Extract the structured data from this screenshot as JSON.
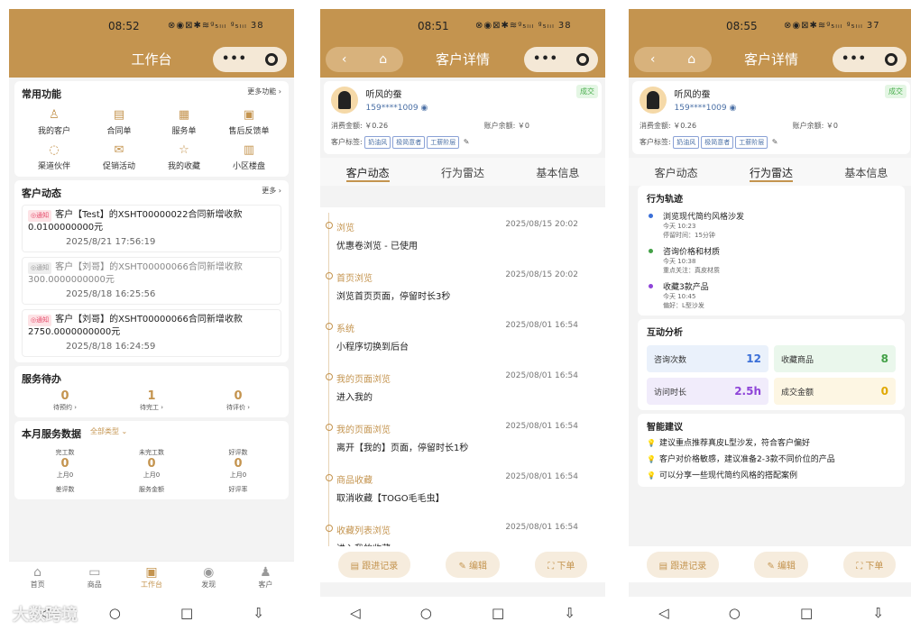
{
  "p1": {
    "time": "08:52",
    "signal": "⊗◉⊠✱≋ᵍ₅ₗᵢₗ ᵍ₅ₗᵢₗ 38",
    "title": "工作台",
    "common": {
      "title": "常用功能",
      "more": "更多功能 ›",
      "items": [
        "我的客户",
        "合同单",
        "服务单",
        "售后反馈单",
        "渠道伙伴",
        "促销活动",
        "我的收藏",
        "小区楼盘"
      ]
    },
    "dyn": {
      "title": "客户动态",
      "more": "更多 ›",
      "items": [
        {
          "tag": "◎通知",
          "text": "客户【Test】的XSHT00000022合同新增收款0.0100000000元",
          "ts": "2025/8/21 17:56:19"
        },
        {
          "tag": "◎通知",
          "text": "客户【刘哥】的XSHT00000066合同新增收款300.0000000000元",
          "ts": "2025/8/18 16:25:56"
        },
        {
          "tag": "◎通知",
          "text": "客户【刘哥】的XSHT00000066合同新增收款2750.0000000000元",
          "ts": "2025/8/18 16:24:59"
        }
      ]
    },
    "todo": {
      "title": "服务待办",
      "items": [
        {
          "n": "0",
          "l": "待预约 ›"
        },
        {
          "n": "1",
          "l": "待完工 ›"
        },
        {
          "n": "0",
          "l": "待评价 ›"
        }
      ]
    },
    "stats": {
      "title": "本月服务数据",
      "filter": "全部类型 ⌄",
      "items": [
        {
          "l": "完工数",
          "n": "0",
          "s": "上月0"
        },
        {
          "l": "未完工数",
          "n": "0",
          "s": "上月0"
        },
        {
          "l": "好评数",
          "n": "0",
          "s": "上月0"
        }
      ],
      "row2": [
        "差评数",
        "服务金额",
        "好评率"
      ]
    },
    "tabs": [
      "首页",
      "商品",
      "工作台",
      "发现",
      "客户"
    ]
  },
  "p2": {
    "time": "08:51",
    "signal": "⊗◉⊠✱≋ᵍ₅ₗᵢₗ ᵍ₅ₗᵢₗ 38",
    "title": "客户详情",
    "cust": {
      "name": "听风的蚕",
      "phone": "159****1009",
      "badge": "成交",
      "consume": "消费金额: ￥0.26",
      "balance": "账户余额: ￥0",
      "tags_label": "客户标签:",
      "tags": [
        "奶油风",
        "极简意者",
        "工薪阶层"
      ]
    },
    "tabs": [
      "客户动态",
      "行为雷达",
      "基本信息"
    ],
    "timeline": [
      {
        "t": "浏览",
        "d": "2025/08/15 20:02",
        "x": "优惠卷浏览 - 已使用"
      },
      {
        "t": "首页浏览",
        "d": "2025/08/15 20:02",
        "x": "浏览首页页面，停留时长3秒"
      },
      {
        "t": "系统",
        "d": "2025/08/01 16:54",
        "x": "小程序切换到后台"
      },
      {
        "t": "我的页面浏览",
        "d": "2025/08/01 16:54",
        "x": "进入我的"
      },
      {
        "t": "我的页面浏览",
        "d": "2025/08/01 16:54",
        "x": "离开【我的】页面，停留时长1秒"
      },
      {
        "t": "商品收藏",
        "d": "2025/08/01 16:54",
        "x": "取消收藏【TOGO毛毛虫】"
      },
      {
        "t": "收藏列表浏览",
        "d": "2025/08/01 16:54",
        "x": "进入我的收藏"
      }
    ],
    "actions": [
      "跟进记录",
      "编辑",
      "下单"
    ]
  },
  "p3": {
    "time": "08:55",
    "signal": "⊗◉⊠✱≋ᵍ₅ₗᵢₗ ᵍ₅ₗᵢₗ 37",
    "title": "客户详情",
    "track": {
      "title": "行为轨迹",
      "items": [
        {
          "a": "浏览现代简约风格沙发",
          "b": "今天 10:23",
          "c": "停留时间：15分钟",
          "color": "#3b6fd8"
        },
        {
          "a": "咨询价格和材质",
          "b": "今天 10:38",
          "c": "重点关注：真皮材质",
          "color": "#43a047"
        },
        {
          "a": "收藏3款产品",
          "b": "今天 10:45",
          "c": "偏好：L型沙发",
          "color": "#8e44d8"
        }
      ]
    },
    "inter": {
      "title": "互动分析",
      "items": [
        {
          "l": "咨询次数",
          "v": "12",
          "bg": "#eaf1fb",
          "c": "#3b6fd8"
        },
        {
          "l": "收藏商品",
          "v": "8",
          "bg": "#eaf7ec",
          "c": "#43a047"
        },
        {
          "l": "访问时长",
          "v": "2.5h",
          "bg": "#f1ecfb",
          "c": "#8e44d8"
        },
        {
          "l": "成交金额",
          "v": "0",
          "bg": "#fdf6e3",
          "c": "#e0a800"
        }
      ]
    },
    "smart": {
      "title": "智能建议",
      "items": [
        "建议重点推荐真皮L型沙发，符合客户偏好",
        "客户对价格敏感，建议准备2-3款不同价位的产品",
        "可以分享一些现代简约风格的搭配案例"
      ]
    }
  },
  "watermark": "大数跨境"
}
